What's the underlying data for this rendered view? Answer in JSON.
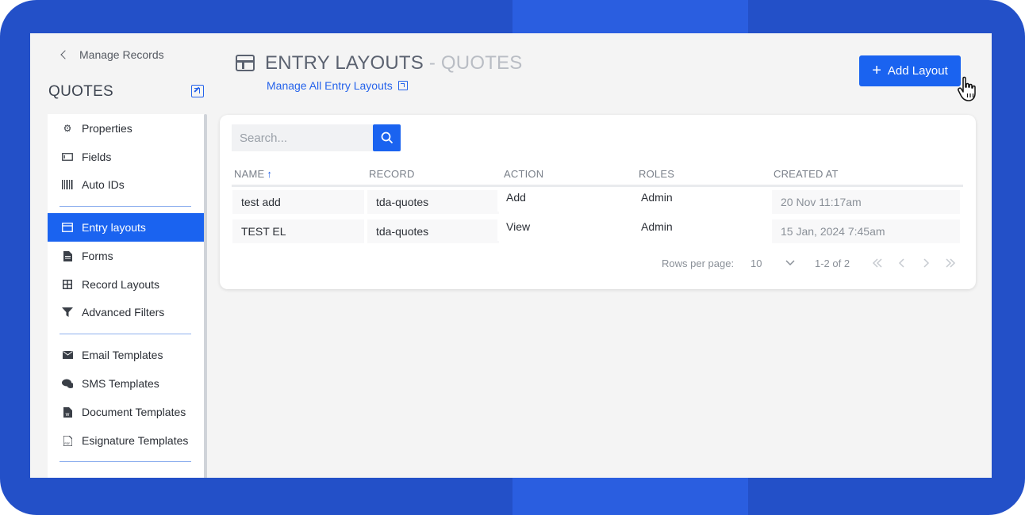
{
  "back_link": "Manage Records",
  "module_title": "QUOTES",
  "sidebar": {
    "items": [
      {
        "label": "Properties",
        "icon": "gear-icon"
      },
      {
        "label": "Fields",
        "icon": "field-icon"
      },
      {
        "label": "Auto IDs",
        "icon": "barcode-icon"
      },
      {
        "label": "Entry layouts",
        "icon": "layout-icon",
        "active": true
      },
      {
        "label": "Forms",
        "icon": "document-icon"
      },
      {
        "label": "Record Layouts",
        "icon": "grid-icon"
      },
      {
        "label": "Advanced Filters",
        "icon": "filter-icon"
      },
      {
        "label": "Email Templates",
        "icon": "envelope-icon"
      },
      {
        "label": "SMS Templates",
        "icon": "chat-icon"
      },
      {
        "label": "Document Templates",
        "icon": "word-doc-icon"
      },
      {
        "label": "Esignature Templates",
        "icon": "pdf-icon"
      }
    ]
  },
  "header": {
    "title": "ENTRY LAYOUTS",
    "title_suffix": " - QUOTES",
    "manage_link": "Manage All Entry Layouts",
    "add_button": "Add Layout"
  },
  "search": {
    "placeholder": "Search..."
  },
  "table": {
    "columns": [
      "NAME",
      "RECORD",
      "ACTION",
      "ROLES",
      "CREATED AT"
    ],
    "rows": [
      {
        "name": "test add",
        "record": "tda-quotes",
        "action": "Add",
        "roles": "Admin",
        "created": "20 Nov  11:17am"
      },
      {
        "name": "TEST EL",
        "record": "tda-quotes",
        "action": "View",
        "roles": "Admin",
        "created": "15 Jan, 2024  7:45am"
      }
    ]
  },
  "pagination": {
    "rows_per_page_label": "Rows per page:",
    "rows_per_page": "10",
    "range": "1-2 of 2"
  },
  "colors": {
    "accent": "#1a63f0",
    "frame": "#2350c8"
  }
}
